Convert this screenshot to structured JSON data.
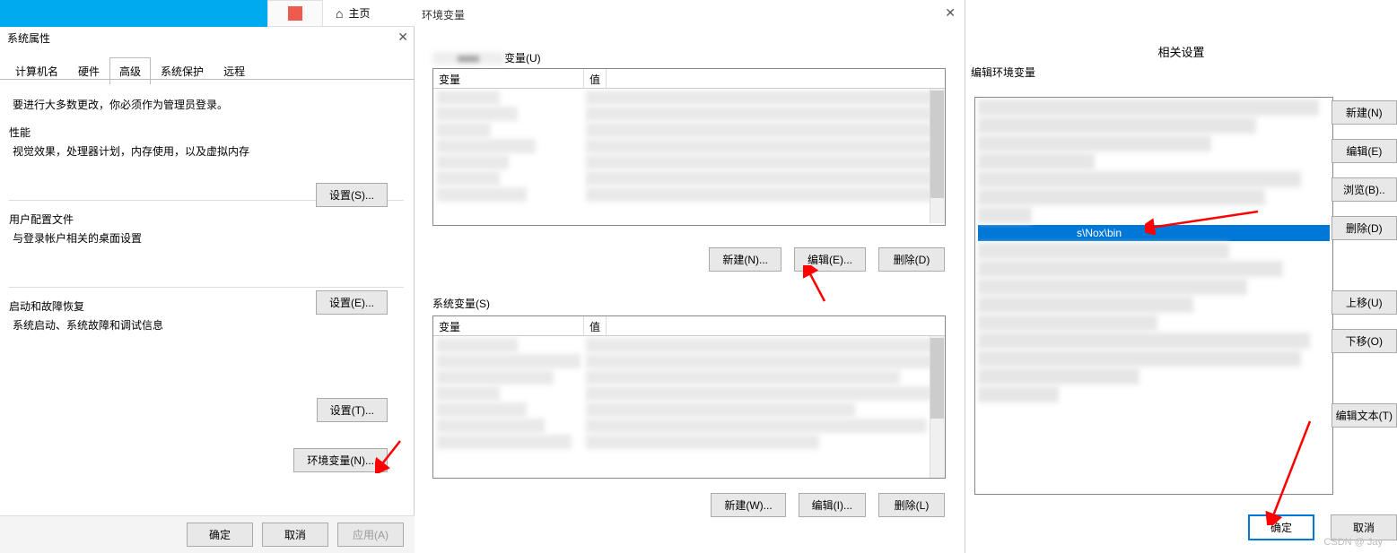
{
  "panel1": {
    "home_label": "主页",
    "dialog_title": "系统属性",
    "tabs": {
      "computer_name": "计算机名",
      "hardware": "硬件",
      "advanced": "高级",
      "system_protection": "系统保护",
      "remote": "远程"
    },
    "admin_text": "要进行大多数更改，你必须作为管理员登录。",
    "perf_title": "性能",
    "perf_desc": "视觉效果，处理器计划，内存使用，以及虚拟内存",
    "settings_s": "设置(S)...",
    "profile_title": "用户配置文件",
    "profile_desc": "与登录帐户相关的桌面设置",
    "settings_e": "设置(E)...",
    "startup_title": "启动和故障恢复",
    "startup_desc": "系统启动、系统故障和调试信息",
    "settings_t": "设置(T)...",
    "env_btn": "环境变量(N)...",
    "ok": "确定",
    "cancel": "取消",
    "apply": "应用(A)"
  },
  "panel2": {
    "title": "环境变量",
    "user_vars": "变量(U)",
    "sys_vars": "系统变量(S)",
    "col_var": "变量",
    "col_val": "值",
    "new_n": "新建(N)...",
    "edit_e": "编辑(E)...",
    "delete_d": "删除(D)",
    "new_w": "新建(W)...",
    "edit_i": "编辑(I)...",
    "delete_l": "删除(L)"
  },
  "panel3": {
    "related": "相关设置",
    "title": "编辑环境变量",
    "selected_value": "s\\Nox\\bin",
    "new": "新建(N)",
    "edit": "编辑(E)",
    "browse": "浏览(B)..",
    "delete": "删除(D)",
    "up": "上移(U)",
    "down": "下移(O)",
    "edit_text": "编辑文本(T)",
    "ok": "确定",
    "cancel": "取消"
  },
  "watermark": "CSDN @ Jay"
}
